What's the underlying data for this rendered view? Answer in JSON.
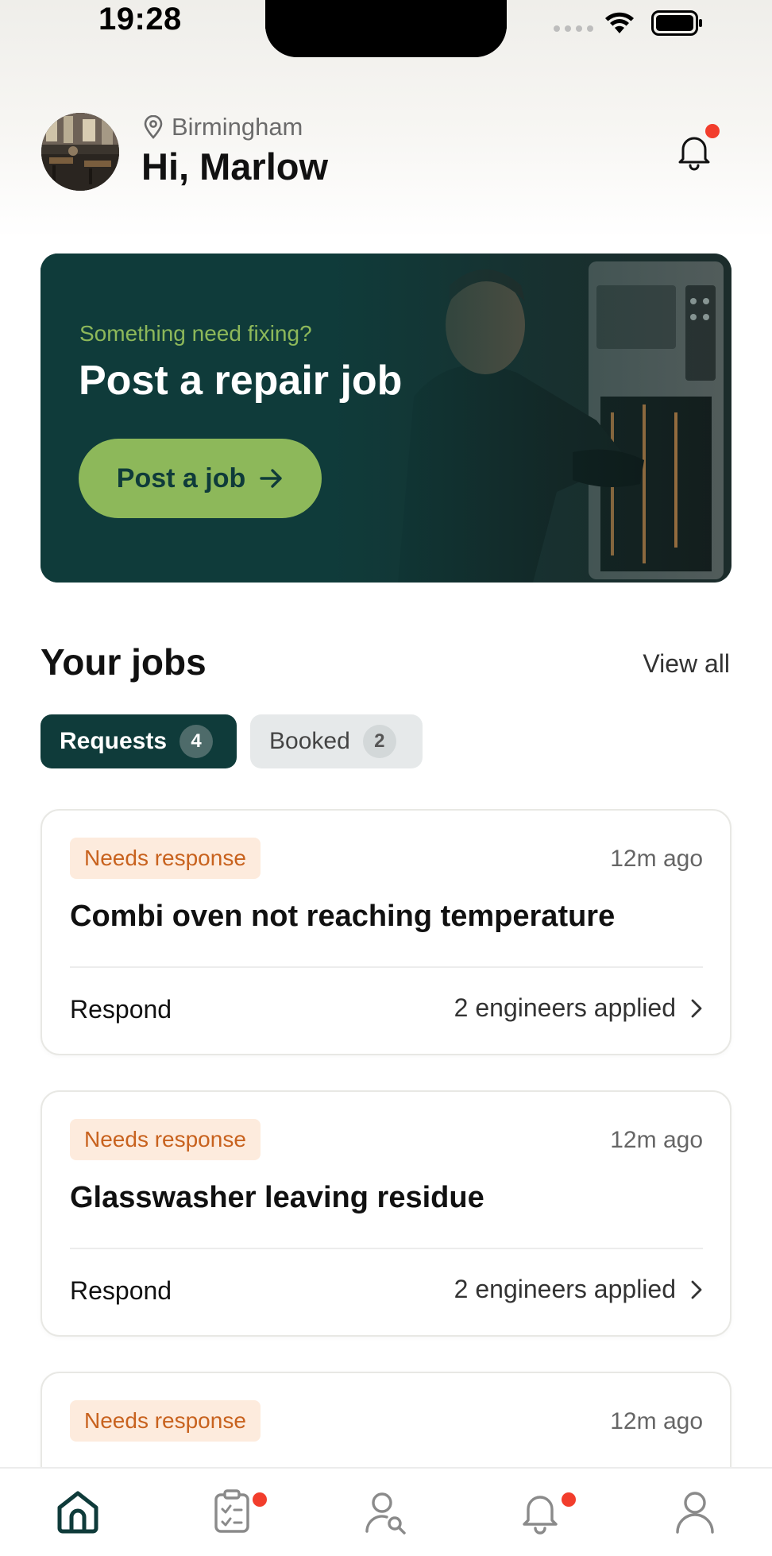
{
  "status_bar": {
    "time": "19:28"
  },
  "header": {
    "location": "Birmingham",
    "greeting": "Hi, Marlow",
    "icons": {
      "location": "location-pin-icon",
      "notifications": "bell-icon"
    },
    "has_notification_dot": true
  },
  "hero": {
    "subtitle": "Something need fixing?",
    "title": "Post a repair job",
    "button_label": "Post a job",
    "button_icon": "arrow-right-icon"
  },
  "jobs": {
    "title": "Your jobs",
    "view_all": "View all",
    "tabs": [
      {
        "label": "Requests",
        "count": "4",
        "active": true
      },
      {
        "label": "Booked",
        "count": "2",
        "active": false
      }
    ],
    "cards": [
      {
        "badge": "Needs response",
        "time": "12m ago",
        "title": "Combi oven not reaching temperature",
        "action": "Respond",
        "applied": "2 engineers applied"
      },
      {
        "badge": "Needs response",
        "time": "12m ago",
        "title": "Glasswasher leaving residue",
        "action": "Respond",
        "applied": "2 engineers applied"
      },
      {
        "badge": "Needs response",
        "time": "12m ago",
        "title": "",
        "action": "",
        "applied": ""
      }
    ]
  },
  "bottom_nav": [
    {
      "icon": "home-icon",
      "active": true,
      "dot": false
    },
    {
      "icon": "clipboard-icon",
      "active": false,
      "dot": true
    },
    {
      "icon": "find-engineer-icon",
      "active": false,
      "dot": false
    },
    {
      "icon": "bell-icon",
      "active": false,
      "dot": true
    },
    {
      "icon": "profile-icon",
      "active": false,
      "dot": false
    }
  ],
  "colors": {
    "brand_dark": "#0f3b3a",
    "accent_green": "#8db85a",
    "badge_bg": "#fdebdd",
    "badge_text": "#c8621e",
    "notification_dot": "#f23d2c"
  }
}
